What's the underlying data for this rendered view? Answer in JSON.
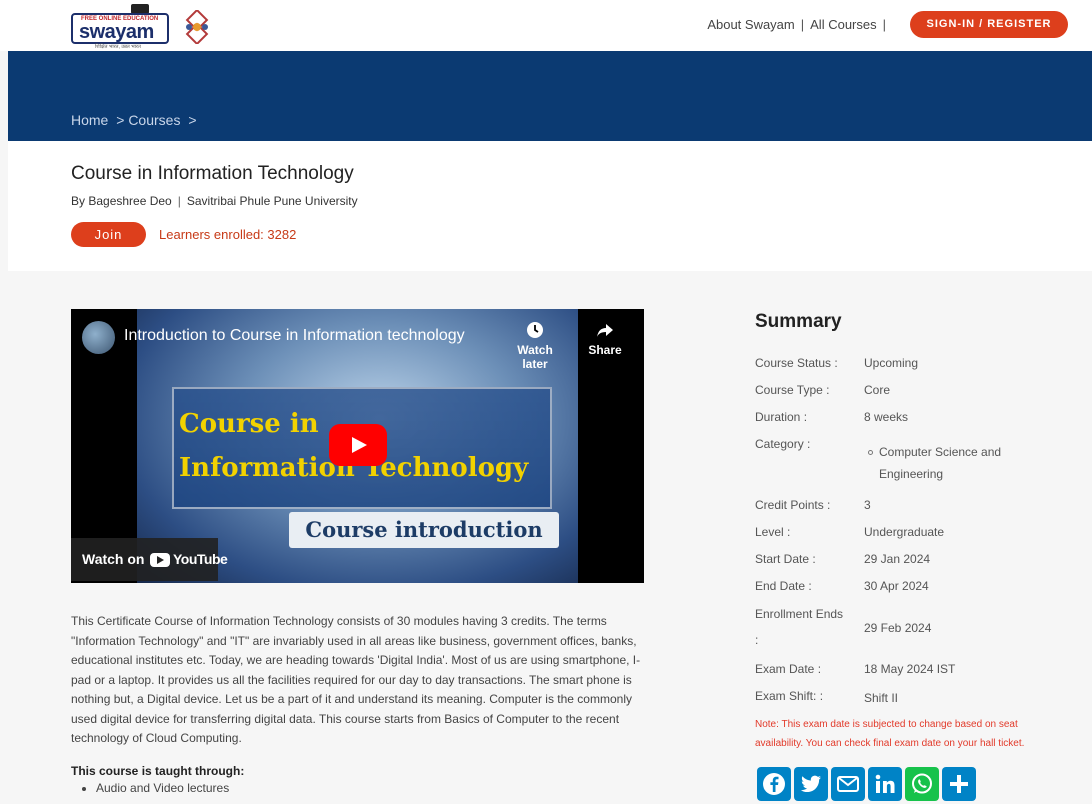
{
  "header": {
    "logo_top": "FREE ONLINE EDUCATION",
    "logo_text": "swayam",
    "logo_sub": "शिक्षित भारत, उन्नत भारत",
    "nav": [
      "About Swayam",
      "All Courses"
    ],
    "nav_sep": "|",
    "signin_label": "SIGN-IN / REGISTER",
    "accent_color": "#dd3f1c",
    "brand_color": "#0b3a72"
  },
  "breadcrumb": [
    "Home",
    "> Courses",
    ">"
  ],
  "course": {
    "title": "Course in Information Technology",
    "instructor": "By Bageshree Deo",
    "sep": "|",
    "institution": "Savitribai Phule Pune University",
    "join_label": "Join",
    "learners": "Learners enrolled: 3282"
  },
  "video": {
    "title": "Introduction to Course in Information technology",
    "watch_later": "Watch later",
    "share": "Share",
    "caption_line1": "Course in",
    "caption_line2": "Information Technology",
    "caption_intro": "Course introduction",
    "watch_on": "Watch on",
    "youtube": "YouTube"
  },
  "description": "This Certificate Course of Information Technology consists of 30 modules having 3 credits. The terms \"Information Technology\" and \"IT\" are invariably used in all areas like business, government offices, banks, educational institutes etc. Today, we are heading towards 'Digital India'. Most of us are using smartphone, I-pad or a laptop. It provides us all the facilities required for our day to day transactions. The smart phone is nothing but, a Digital device. Let us be a part of it and understand its meaning. Computer is the commonly used digital device for transferring digital data. This course starts from Basics of Computer to the recent technology of Cloud Computing.",
  "taught": {
    "heading": "This course is taught through:",
    "items": [
      "Audio and Video lectures"
    ]
  },
  "summary": {
    "title": "Summary",
    "rows": [
      {
        "label": "Course Status :",
        "value": "Upcoming"
      },
      {
        "label": "Course Type :",
        "value": "Core"
      },
      {
        "label": "Duration :",
        "value": "8 weeks"
      },
      {
        "label": "Category :",
        "value": "Computer Science and Engineering"
      },
      {
        "label": "Credit Points :",
        "value": "3"
      },
      {
        "label": "Level :",
        "value": "Undergraduate"
      },
      {
        "label": "Start Date :",
        "value": "29 Jan 2024"
      },
      {
        "label": "End Date :",
        "value": "30 Apr 2024"
      },
      {
        "label": "Enrollment Ends",
        "value": "29 Feb 2024"
      },
      {
        "label": "Exam Date :",
        "value": "18 May 2024 IST"
      },
      {
        "label": "Exam Shift: :",
        "value": "Shift II"
      }
    ],
    "enrollment_colon": ":",
    "note": "Note: This exam date is subjected to change based on seat availability. You can check final exam date on your hall ticket."
  },
  "social": [
    "facebook-icon",
    "twitter-icon",
    "email-icon",
    "linkedin-icon",
    "whatsapp-icon",
    "share-plus-icon"
  ]
}
